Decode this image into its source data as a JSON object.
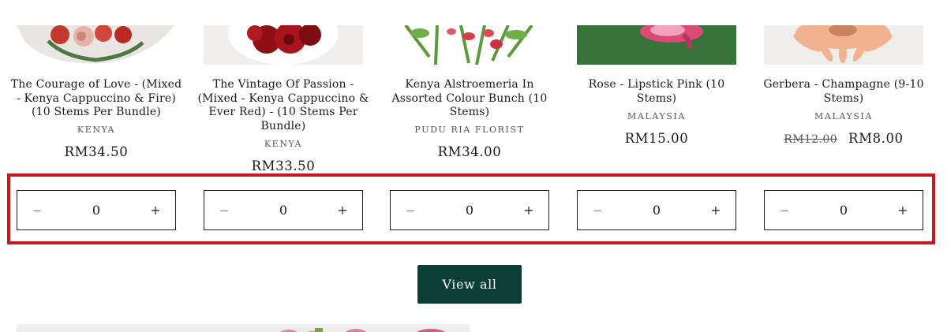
{
  "products": [
    {
      "title": "The Courage of Love - (Mixed - Kenya Cappuccino & Fire) (10 Stems Per Bundle)",
      "vendor": "KENYA",
      "price": "RM34.50",
      "compare_price": null,
      "quantity": "0",
      "image_icon": "mixed-rose-bouquet-image"
    },
    {
      "title": "The Vintage Of Passion - (Mixed - Kenya Cappuccino & Ever Red) - (10 Stems Per Bundle)",
      "vendor": "KENYA",
      "price": "RM33.50",
      "compare_price": null,
      "quantity": "0",
      "image_icon": "red-rose-bouquet-image"
    },
    {
      "title": "Kenya Alstroemeria In Assorted Colour Bunch (10 Stems)",
      "vendor": "PUDU RIA FLORIST",
      "price": "RM34.00",
      "compare_price": null,
      "quantity": "0",
      "image_icon": "alstroemeria-bunch-image"
    },
    {
      "title": "Rose - Lipstick Pink (10 Stems)",
      "vendor": "MALAYSIA",
      "price": "RM15.00",
      "compare_price": null,
      "quantity": "0",
      "image_icon": "pink-rose-image"
    },
    {
      "title": "Gerbera - Champagne (9-10 Stems)",
      "vendor": "MALAYSIA",
      "price": "RM8.00",
      "compare_price": "RM12.00",
      "quantity": "0",
      "image_icon": "gerbera-image"
    }
  ],
  "stepper": {
    "minus_label": "−",
    "plus_label": "+"
  },
  "view_all_label": "View all",
  "colors": {
    "accent": "#0a3d34",
    "highlight": "#c8181e",
    "text": "#1a1a1a",
    "muted": "#555555"
  }
}
